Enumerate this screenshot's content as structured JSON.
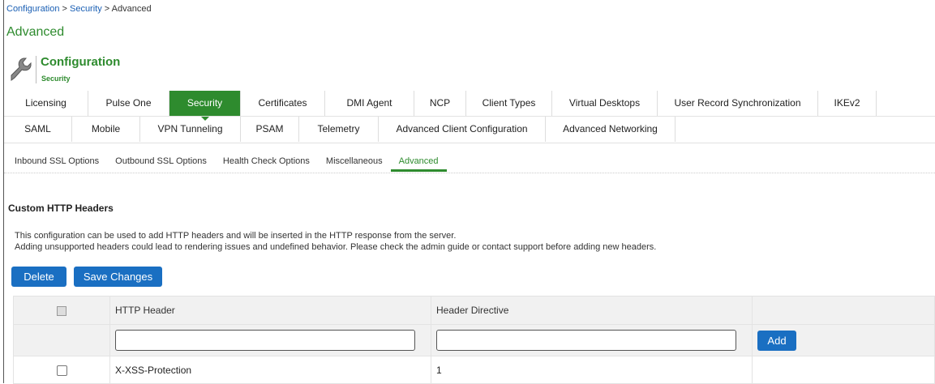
{
  "breadcrumb": {
    "part1": "Configuration",
    "sep1": " > ",
    "part2": "Security",
    "sep2": " > ",
    "part3": "Advanced"
  },
  "page_title": "Advanced",
  "config_header": {
    "title": "Configuration",
    "subtitle": "Security"
  },
  "main_tabs_row1": [
    {
      "label": "Licensing"
    },
    {
      "label": "Pulse One"
    },
    {
      "label": "Security",
      "active": true
    },
    {
      "label": "Certificates"
    },
    {
      "label": "DMI Agent"
    },
    {
      "label": "NCP"
    },
    {
      "label": "Client Types"
    },
    {
      "label": "Virtual Desktops"
    },
    {
      "label": "User Record Synchronization"
    },
    {
      "label": "IKEv2"
    }
  ],
  "main_tabs_row2": [
    {
      "label": "SAML"
    },
    {
      "label": "Mobile"
    },
    {
      "label": "VPN Tunneling"
    },
    {
      "label": "PSAM"
    },
    {
      "label": "Telemetry"
    },
    {
      "label": "Advanced Client Configuration"
    },
    {
      "label": "Advanced Networking"
    }
  ],
  "sub_tabs": [
    {
      "label": "Inbound SSL Options"
    },
    {
      "label": "Outbound SSL Options"
    },
    {
      "label": "Health Check Options"
    },
    {
      "label": "Miscellaneous"
    },
    {
      "label": "Advanced",
      "active": true
    }
  ],
  "section": {
    "title": "Custom HTTP Headers",
    "desc1": "This configuration can be used to add HTTP headers and will be inserted in the HTTP response from the server.",
    "desc2": "Adding unsupported headers could lead to rendering issues and undefined behavior. Please check the admin guide or contact support before adding new headers."
  },
  "buttons": {
    "delete": "Delete",
    "save": "Save Changes",
    "add": "Add"
  },
  "table": {
    "columns": [
      "HTTP Header",
      "Header Directive"
    ],
    "new_header_value": "",
    "new_directive_value": "",
    "rows": [
      {
        "header": "X-XSS-Protection",
        "directive": "1",
        "checked": false
      }
    ]
  },
  "colors": {
    "accent_green": "#2e8b2e",
    "button_blue": "#1a6fc2",
    "link_blue": "#1a5fb4"
  },
  "icons": {
    "config": "wrench-icon"
  }
}
